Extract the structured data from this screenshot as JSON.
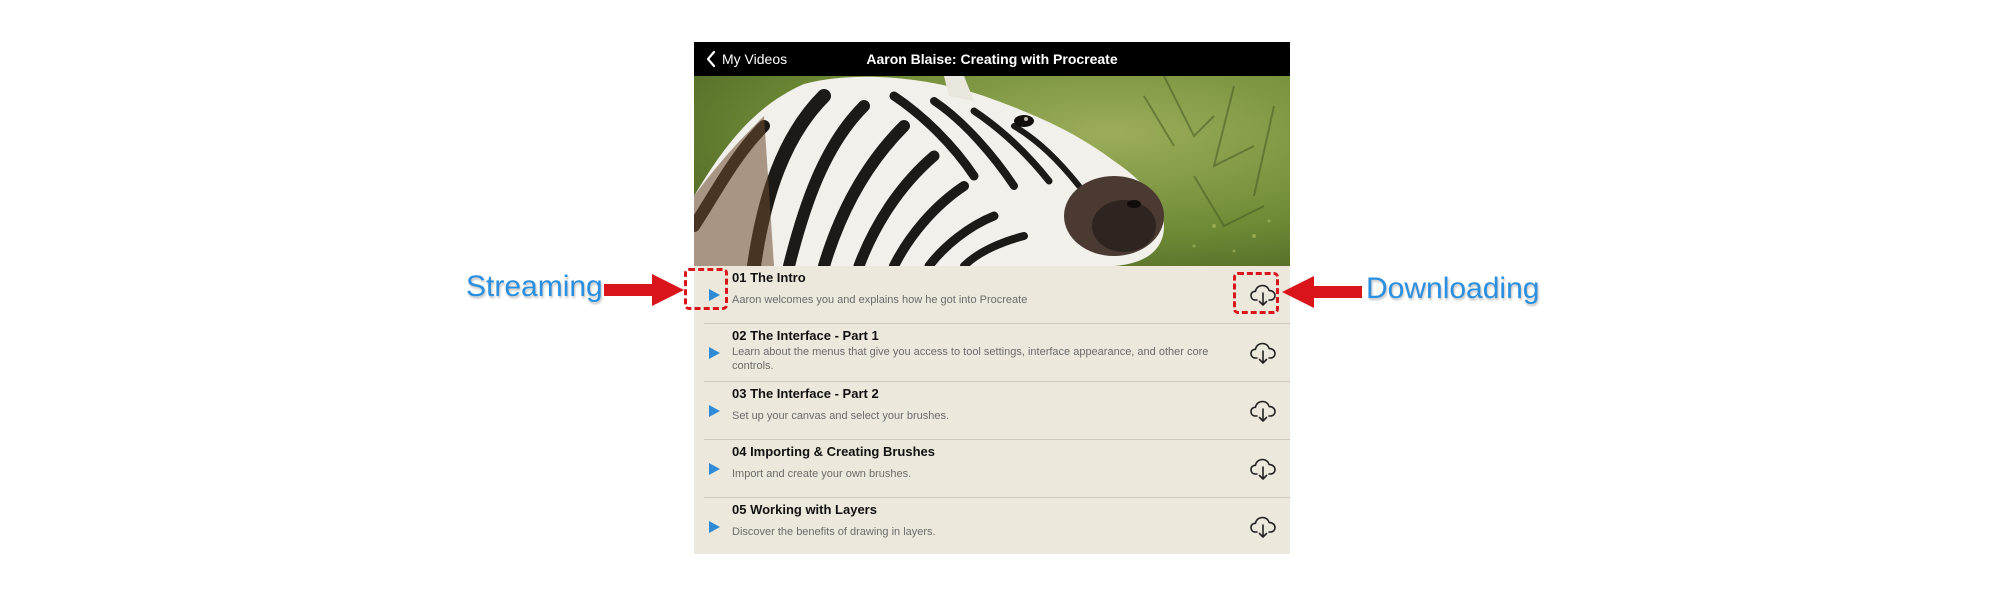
{
  "navbar": {
    "back_label": "My Videos",
    "title": "Aaron Blaise: Creating with Procreate"
  },
  "hero": {
    "description": "Painting of a zebra's head in profile against a green background"
  },
  "lessons": [
    {
      "title": "01 The Intro",
      "description": "Aaron welcomes you and explains how he got into Procreate"
    },
    {
      "title": "02 The Interface - Part 1",
      "description": "Learn about the menus that give you access to tool settings, interface appearance, and other core controls."
    },
    {
      "title": "03 The Interface - Part 2",
      "description": "Set up your canvas and select your brushes."
    },
    {
      "title": "04 Importing & Creating Brushes",
      "description": "Import and create your own brushes."
    },
    {
      "title": "05 Working with Layers",
      "description": "Discover the benefits of drawing in layers."
    }
  ],
  "annotations": {
    "left_label": "Streaming",
    "right_label": "Downloading"
  },
  "icons": {
    "back": "chevron-left-icon",
    "play": "play-icon",
    "download": "cloud-download-icon"
  },
  "colors": {
    "navbar_bg": "#000000",
    "list_bg": "#ece8dc",
    "play_blue": "#2f8ad6",
    "annotation_red": "#d9141a",
    "annotation_blue": "#2b8fe0"
  }
}
